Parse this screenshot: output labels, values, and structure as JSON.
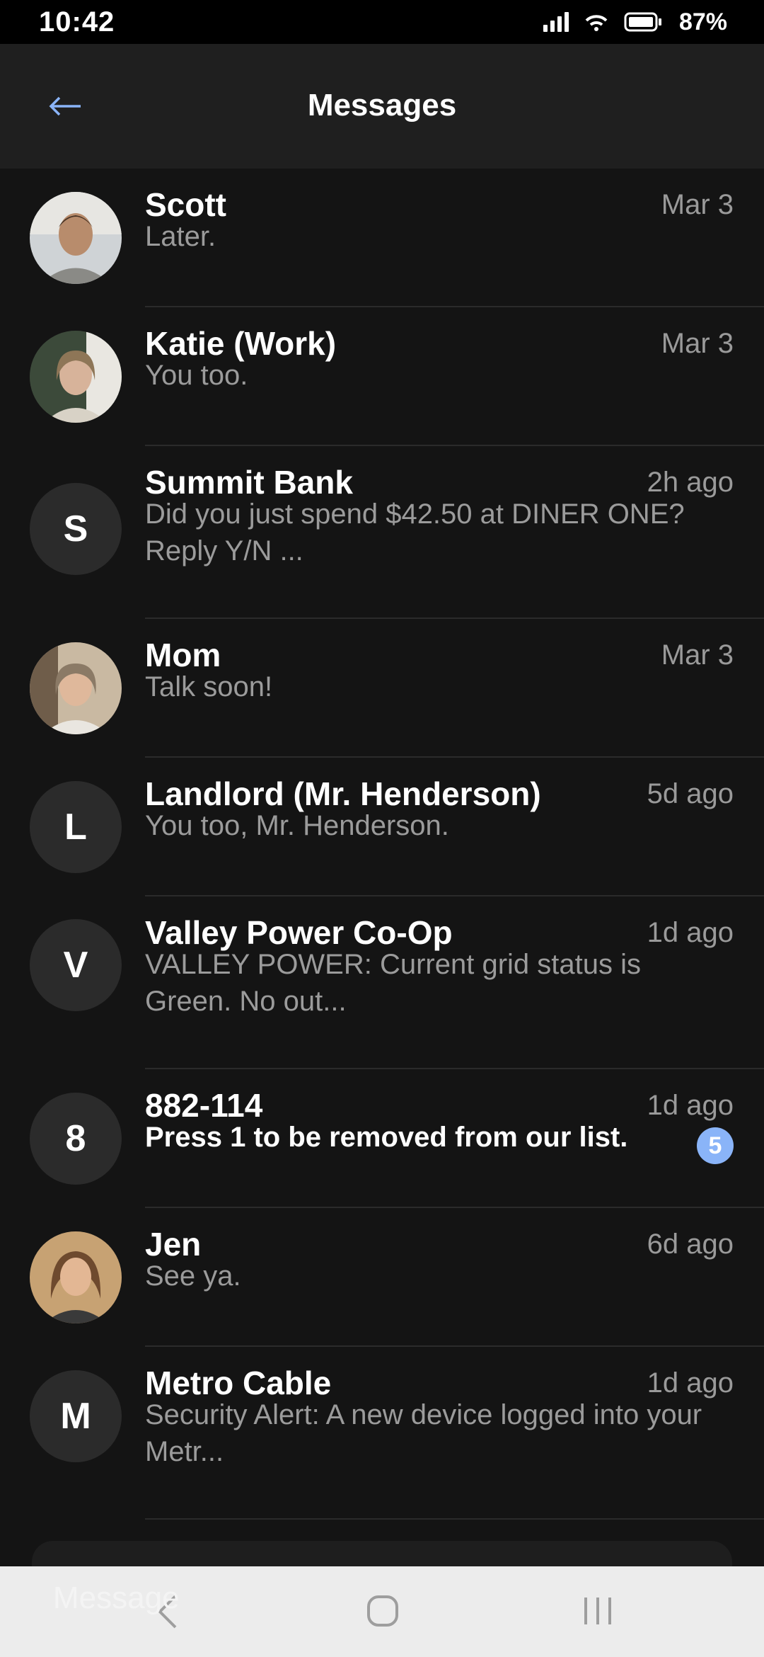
{
  "status_bar": {
    "time": "10:42",
    "battery": "87%"
  },
  "header": {
    "title": "Messages"
  },
  "conversations": [
    {
      "name": "Scott",
      "time": "Mar 3",
      "preview": "Later.",
      "avatar": "photo"
    },
    {
      "name": "Katie (Work)",
      "time": "Mar 3",
      "preview": "You too.",
      "avatar": "photo"
    },
    {
      "name": "Summit Bank",
      "time": "2h ago",
      "preview": "Did you just spend $42.50 at DINER ONE? Reply Y/N ...",
      "initial": "S"
    },
    {
      "name": "Mom",
      "time": "Mar 3",
      "preview": "Talk soon!",
      "avatar": "photo"
    },
    {
      "name": "Landlord (Mr. Henderson)",
      "time": "5d ago",
      "preview": "You too, Mr. Henderson.",
      "initial": "L"
    },
    {
      "name": "Valley Power Co-Op",
      "time": "1d ago",
      "preview": "VALLEY POWER: Current grid status is Green. No out...",
      "initial": "V"
    },
    {
      "name": "882-114",
      "time": "1d ago",
      "preview": "Press 1 to be removed from our list.",
      "initial": "8",
      "unread_count": "5"
    },
    {
      "name": "Jen",
      "time": "6d ago",
      "preview": "See ya.",
      "avatar": "photo"
    },
    {
      "name": "Metro Cable",
      "time": "1d ago",
      "preview": "Security Alert: A new device logged into your Metr...",
      "initial": "M"
    }
  ],
  "compose": {
    "placeholder": "Message"
  },
  "colors": {
    "accent": "#8ab4f8",
    "background": "#141414",
    "app_bar": "#1f1f1f"
  },
  "icons": {
    "back": "arrow-left-icon",
    "nav_back": "chevron-left-icon",
    "nav_home": "circle-home-icon",
    "nav_recents": "recents-icon"
  }
}
